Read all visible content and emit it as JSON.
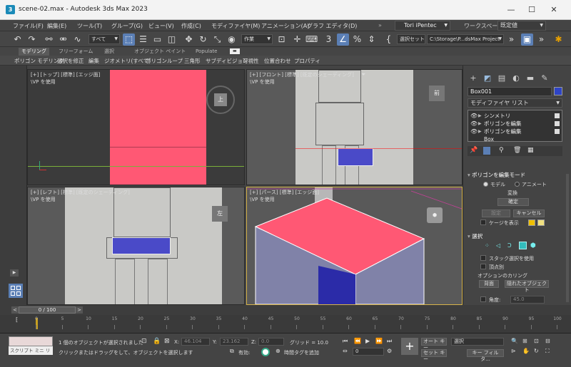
{
  "window": {
    "title": "scene-02.max - Autodesk 3ds Max 2023",
    "app_icon_letter": "3",
    "controls": {
      "minimize": "—",
      "maximize": "☐",
      "close": "✕"
    }
  },
  "menu": {
    "items": [
      "ファイル(F)",
      "編集(E)",
      "ツール(T)",
      "グループ(G)",
      "ビュー(V)",
      "作成(C)",
      "モディファイヤ(M)",
      "アニメーション(A)",
      "グラフ エディタ(D)"
    ],
    "more": "»",
    "user": "Tori iPentec",
    "workspace_label": "ワークスペース:",
    "workspace_value": "既定値"
  },
  "toolbar": {
    "selection_filter": "すべて",
    "coord_system": "作業",
    "named_selection": "選択セット",
    "project_path": "C:\\Storage\\P...dsMax Project",
    "icons": [
      "undo-icon",
      "redo-icon",
      "link-icon",
      "unlink-icon",
      "bind-spacewarp-icon",
      "select-object-icon",
      "select-by-name-icon",
      "rect-selection-icon",
      "window-crossing-icon",
      "select-move-icon",
      "select-rotate-icon",
      "select-scale-icon",
      "place-icon",
      "use-pivot-icon",
      "select-manipulate-icon",
      "keyboard-shortcut-icon",
      "snap-3d-icon",
      "angle-snap-icon",
      "percent-snap-icon",
      "spinner-snap-icon",
      "edit-named-sel-icon",
      "render-setup-icon"
    ]
  },
  "ribbon": {
    "tabs": [
      "モデリング",
      "フリーフォーム",
      "選択",
      "オブジェクト ペイント",
      "Populate"
    ],
    "active_tab": "モデリング",
    "sub_items": [
      "ポリゴン モデリング",
      "選択を修正",
      "編集",
      "ジオメトリ(すべて)",
      "ポリゴン",
      "ループ",
      "三角形",
      "サブディビジョン",
      "可視性",
      "位置合わせ",
      "プロパティ"
    ]
  },
  "viewports": {
    "top": {
      "label": "[+] [トップ] [標準] [エッジ面]",
      "sub": "\\VP を使用",
      "nav_cube": "上"
    },
    "front": {
      "label": "[+] [フロント] [標準] [既定のシェーディング]",
      "sub": "\\VP を使用",
      "nav_cube": "前"
    },
    "left": {
      "label": "[+] [レフト] [標準] [既定のシェーディング]",
      "sub": "\\VP を使用",
      "nav_cube": "左"
    },
    "perspective": {
      "label": "[+] [パース] [標準] [エッジ面]",
      "sub": "\\VP を使用"
    }
  },
  "command_panel": {
    "object_name": "Box001",
    "object_color": "#2e44c6",
    "modifier_list": "モディファイヤ リスト",
    "stack": [
      "シンメトリ",
      "ポリゴンを編集",
      "ポリゴンを編集",
      "Box"
    ],
    "edit_mode_header": "ポリゴンを編集モード",
    "radio_model": "モデル",
    "radio_animate": "アニメート",
    "label_transform": "変換",
    "btn_commit": "確定",
    "btn_settings": "設定",
    "btn_cancel": "キャンセル",
    "label_show_cage": "ケージを表示",
    "cage_color1": "#f0c000",
    "cage_color2": "#f0e080",
    "select_header": "選択",
    "label_by_vertex_lock": "スタック選択を使用",
    "label_by_vertex": "頂点別",
    "ignore_header": "オプションのカリング",
    "btn_backface": "背面",
    "btn_hidden_obj": "隠れたオブジェクト",
    "label_angle": "角度:",
    "angle_value": "45.0"
  },
  "timeline": {
    "frame_display": "0 / 100",
    "prev": "<",
    "next": ">",
    "ticks": [
      "0",
      "5",
      "10",
      "15",
      "20",
      "25",
      "30",
      "35",
      "40",
      "45",
      "50",
      "55",
      "60",
      "65",
      "70",
      "75",
      "80",
      "85",
      "90",
      "95",
      "100"
    ]
  },
  "status": {
    "maxscript_label": "スクリプト ミニ リス",
    "line1": "1 個のオブジェクトが選択されました",
    "line2": "クリックまたはドラッグをして、オブジェクトを選択します",
    "x_label": "X:",
    "x_value": "46.104",
    "y_label": "Y:",
    "y_value": "23.162",
    "z_label": "Z:",
    "z_value": "0.0",
    "grid": "グリッド = 10.0",
    "enabled_label": "有効:",
    "add_time_tag": "時間タグを追加",
    "auto_key": "オート キー",
    "set_key": "セット キー",
    "selected": "選択",
    "key_filter": "キー フィルタ...",
    "frame_value": "0"
  }
}
